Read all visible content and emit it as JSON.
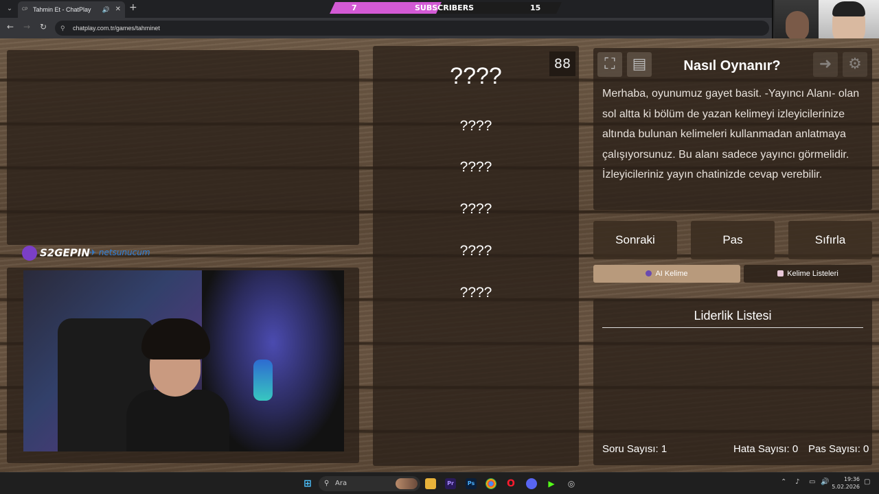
{
  "browser": {
    "tab_title": "Tahmin Et - ChatPlay",
    "tab_favicon": "CP",
    "url": "chatplay.com.tr/games/tahminet"
  },
  "subscribers_bar": {
    "label": "SUBSCRIBERS",
    "current": "7",
    "goal": "15",
    "progress_fraction": 0.47,
    "color": "#d35ad5"
  },
  "sponsors": {
    "sponsor1": "S2GEPIN",
    "sponsor2": "netsunucum"
  },
  "game": {
    "counter": "88",
    "main_word": "????",
    "forbidden_words": [
      "????",
      "????",
      "????",
      "????",
      "????"
    ]
  },
  "how_to": {
    "title": "Nasıl Oynanır?",
    "text": "Merhaba, oyunumuz gayet basit. -Yayıncı Alanı- olan sol altta ki bölüm de yazan kelimeyi izleyicilerinize altında bulunan kelimeleri kullanmadan anlatmaya çalışıyorsunuz. Bu alanı sadece yayıncı görmelidir. İzleyicileriniz yayın chatinizde cevap verebilir."
  },
  "controls": {
    "next": "Sonraki",
    "pass": "Pas",
    "reset": "Sıfırla",
    "ai_word": "AI Kelime",
    "word_lists": "Kelime Listeleri"
  },
  "leaderboard": {
    "title": "Liderlik Listesi",
    "question_count": "Soru Sayısı: 1",
    "error_count": "Hata Sayısı: 0",
    "pass_count": "Pas Sayısı: 0"
  },
  "taskbar": {
    "search_placeholder": "Ara",
    "time": "19:36",
    "date": "5.02.2026"
  },
  "colors": {
    "accent": "#d35ad5",
    "panel": "#2a2018",
    "ai_button": "#b89a7c"
  }
}
